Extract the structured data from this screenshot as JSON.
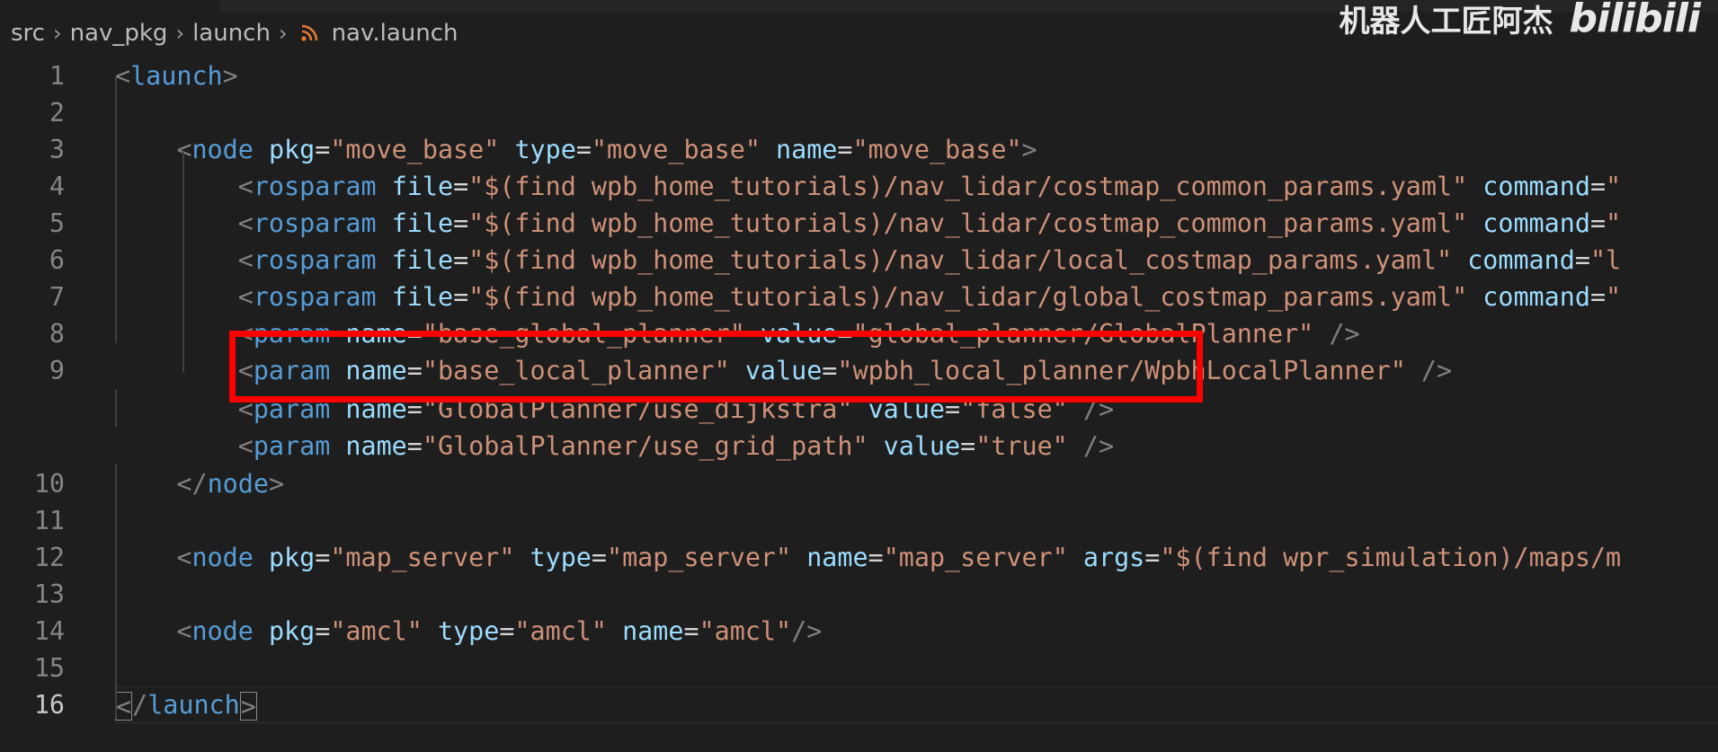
{
  "breadcrumb": {
    "items": [
      "src",
      "nav_pkg",
      "launch"
    ],
    "file": "nav.launch",
    "file_icon": "rss-icon"
  },
  "watermark": {
    "channel": "机器人工匠阿杰",
    "logo": "bilibili"
  },
  "colors": {
    "background": "#1e1e1e",
    "tag": "#569cd6",
    "attribute": "#9cdcfe",
    "string": "#ce9178",
    "bracket": "#808080",
    "highlight": "#ff0000"
  },
  "editor": {
    "current_line": "16",
    "lines": [
      {
        "no": "1",
        "code": "<launch>"
      },
      {
        "no": "2",
        "code": ""
      },
      {
        "no": "3",
        "code": "    <node pkg=\"move_base\" type=\"move_base\" name=\"move_base\">"
      },
      {
        "no": "4",
        "code": "        <rosparam file=\"$(find wpb_home_tutorials)/nav_lidar/costmap_common_params.yaml\" command=\""
      },
      {
        "no": "5",
        "code": "        <rosparam file=\"$(find wpb_home_tutorials)/nav_lidar/costmap_common_params.yaml\" command=\""
      },
      {
        "no": "6",
        "code": "        <rosparam file=\"$(find wpb_home_tutorials)/nav_lidar/local_costmap_params.yaml\" command=\"l"
      },
      {
        "no": "7",
        "code": "        <rosparam file=\"$(find wpb_home_tutorials)/nav_lidar/global_costmap_params.yaml\" command=\""
      },
      {
        "no": "8",
        "code": "        <param name=\"base_global_planner\" value=\"global_planner/GlobalPlanner\" />"
      },
      {
        "no": "9",
        "code": "        <param name=\"base_local_planner\" value=\"wpbh_local_planner/WpbhLocalPlanner\" />"
      },
      {
        "no": "",
        "code": "        <param name=\"GlobalPlanner/use_dijkstra\" value=\"false\" />"
      },
      {
        "no": "",
        "code": "        <param name=\"GlobalPlanner/use_grid_path\" value=\"true\" />"
      },
      {
        "no": "10",
        "code": "    </node>"
      },
      {
        "no": "11",
        "code": ""
      },
      {
        "no": "12",
        "code": "    <node pkg=\"map_server\" type=\"map_server\" name=\"map_server\" args=\"$(find wpr_simulation)/maps/m"
      },
      {
        "no": "13",
        "code": ""
      },
      {
        "no": "14",
        "code": "    <node pkg=\"amcl\" type=\"amcl\" name=\"amcl\"/>"
      },
      {
        "no": "15",
        "code": ""
      },
      {
        "no": "16",
        "code": "</launch>"
      }
    ]
  }
}
